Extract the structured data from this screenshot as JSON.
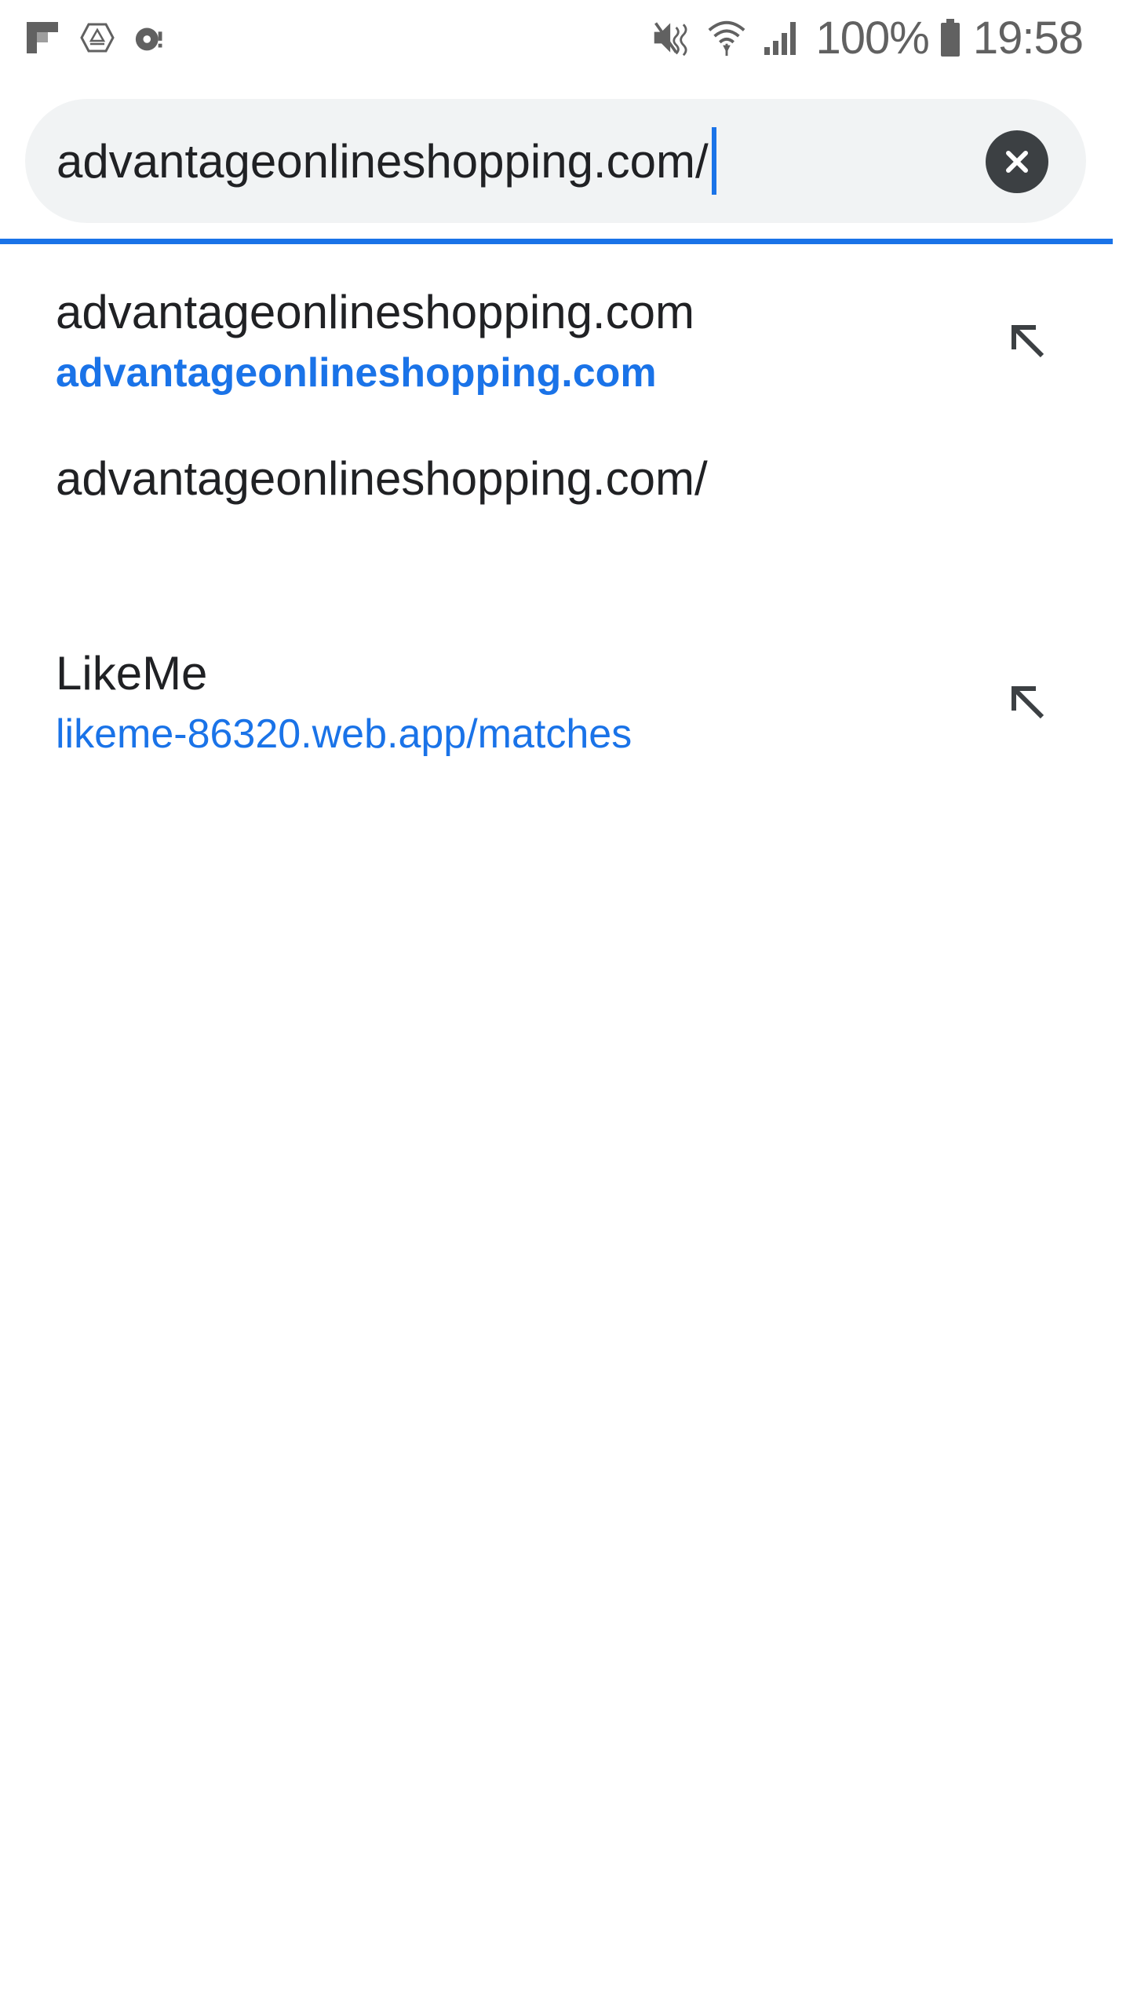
{
  "status_bar": {
    "left_icons": [
      "flipboard-icon",
      "hexagon-app-icon",
      "vpn-key-icon"
    ],
    "right_icons": [
      "mute-icon",
      "wifi-icon",
      "signal-icon",
      "battery-icon"
    ],
    "battery_percent": "100%",
    "time": "19:58"
  },
  "omnibox": {
    "value": "advantageonlineshopping.com/",
    "clear_icon": "close-icon"
  },
  "suggestions": [
    {
      "title": "advantageonlineshopping.com",
      "url": "advantageonlineshopping.com",
      "url_bold": true,
      "action_icon": "arrow-up-left-icon"
    },
    {
      "title": "advantageonlineshopping.com/"
    },
    {
      "title": "LikeMe",
      "url": "likeme-86320.web.app/matches",
      "url_bold": false,
      "action_icon": "arrow-up-left-icon"
    }
  ],
  "colors": {
    "accent": "#1a73e8",
    "omnibox_bg": "#f1f3f4",
    "text": "#202124",
    "icon_dark": "#3c4043"
  }
}
